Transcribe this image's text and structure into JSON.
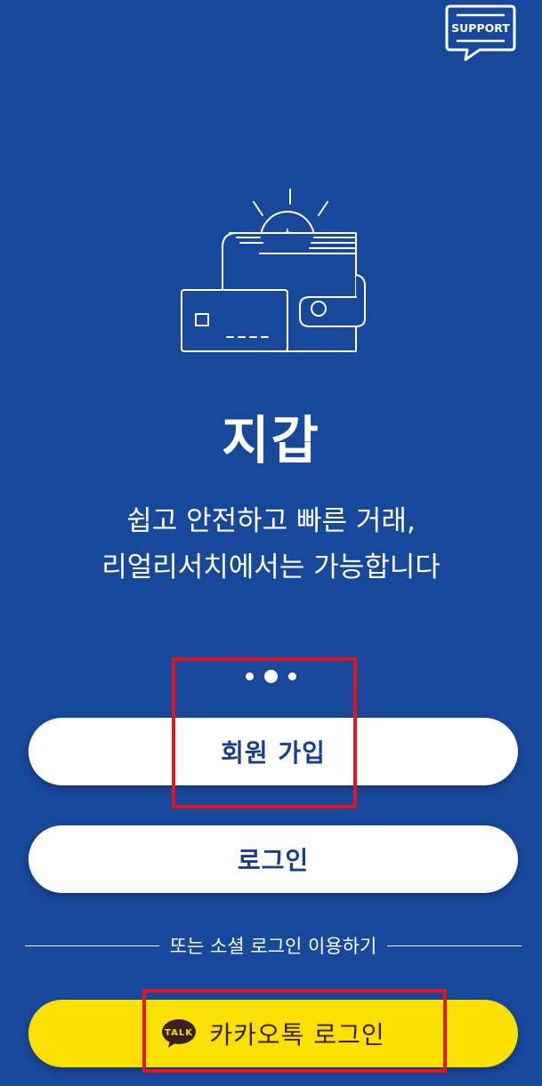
{
  "support": {
    "label": "SUPPORT",
    "icon": "support-chat-icon"
  },
  "illustration": {
    "icon": "wallet-coin-card-icon"
  },
  "title": "지갑",
  "subtitle": {
    "line1": "쉽고 안전하고 빠른 거래,",
    "line2": "리얼리서치에서는 가능합니다"
  },
  "pagination": {
    "total": 3,
    "active_index": 1
  },
  "buttons": {
    "signup_label": "회원 가입",
    "login_label": "로그인",
    "kakao_label": "카카오톡 로그인",
    "kakao_icon_text": "TALK"
  },
  "divider": {
    "text": "또는 소셜 로그인 이용하기"
  },
  "colors": {
    "background": "#18489b",
    "primary_text": "#1a3f8a",
    "kakao_yellow": "#fae100",
    "kakao_brown": "#3b1e1e",
    "highlight_red": "#e5141e"
  }
}
